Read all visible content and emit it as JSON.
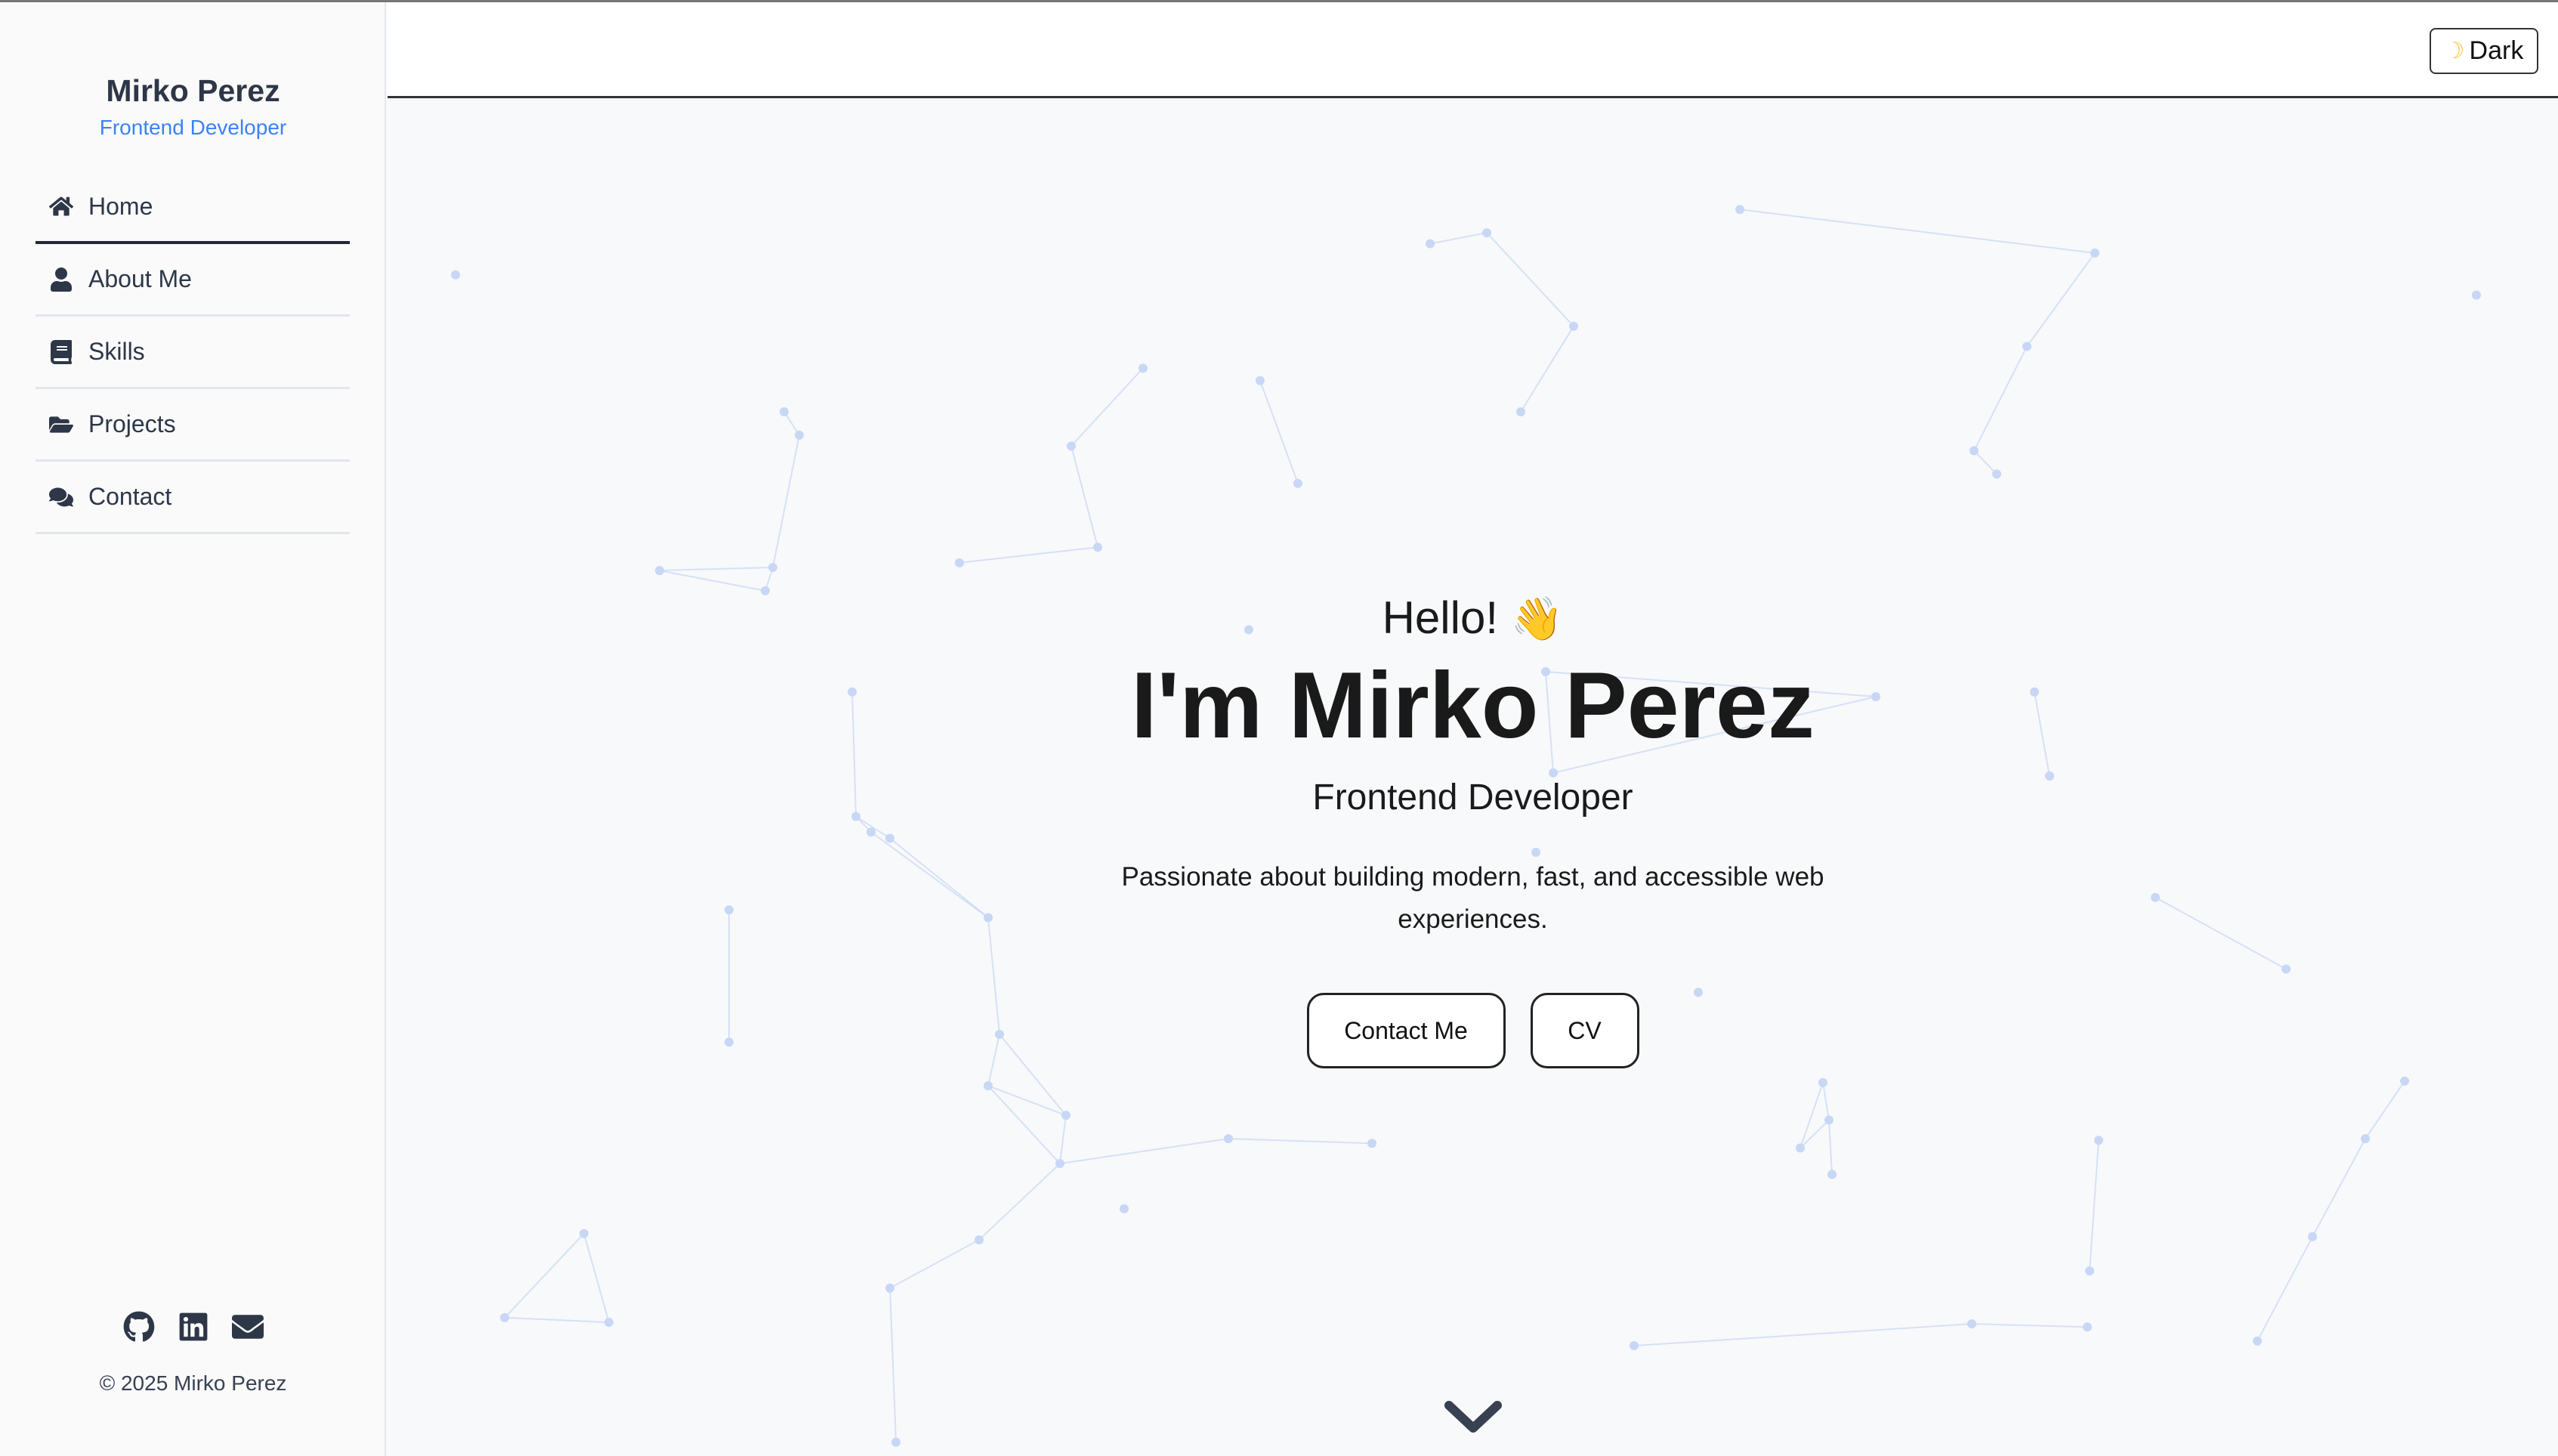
{
  "sidebar": {
    "name": "Mirko Perez",
    "role": "Frontend Developer",
    "nav": [
      {
        "label": "Home",
        "icon": "home-icon"
      },
      {
        "label": "About Me",
        "icon": "user-icon"
      },
      {
        "label": "Skills",
        "icon": "book-icon"
      },
      {
        "label": "Projects",
        "icon": "folder-icon"
      },
      {
        "label": "Contact",
        "icon": "comments-icon"
      }
    ],
    "socials": [
      "github-icon",
      "linkedin-icon",
      "envelope-icon"
    ],
    "copyright": "© 2025 Mirko Perez"
  },
  "topbar": {
    "theme_label": "Dark",
    "theme_icon": "moon-icon"
  },
  "hero": {
    "greeting": "Hello!",
    "wave": "👋",
    "title": "I'm Mirko Perez",
    "role": "Frontend Developer",
    "description": "Passionate about building modern, fast, and accessible web experiences.",
    "contact_label": "Contact Me",
    "cv_label": "CV"
  },
  "colors": {
    "accent": "#3b82f6",
    "particle": "#c7d7f5"
  }
}
